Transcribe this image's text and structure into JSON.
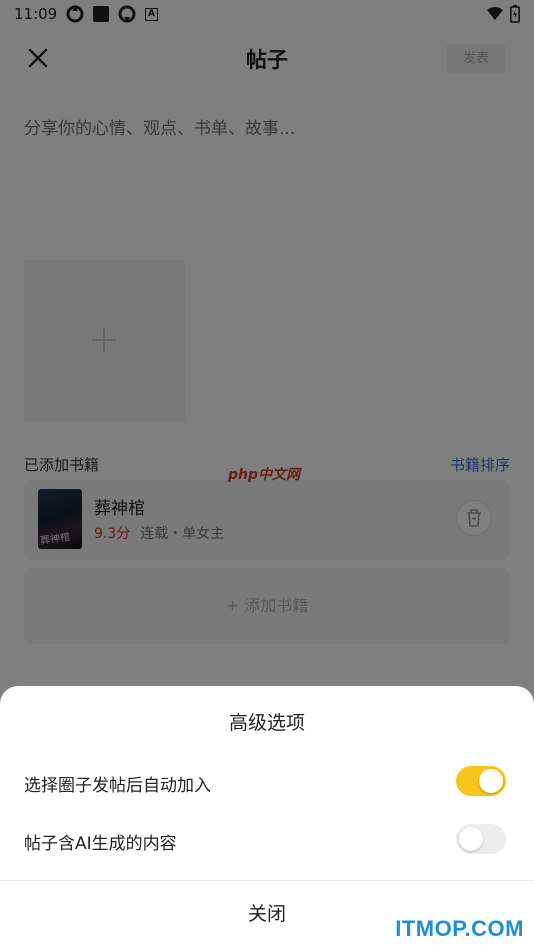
{
  "status_bar": {
    "time": "11:09"
  },
  "topbar": {
    "title": "帖子",
    "publish_label": "发表"
  },
  "post": {
    "placeholder": "分享你的心情、观点、书单、故事..."
  },
  "books": {
    "section_label": "已添加书籍",
    "sort_label": "书籍排序",
    "items": [
      {
        "title": "葬神棺",
        "cover_text": "葬神棺",
        "score": "9.3分",
        "tags": "连载・单女主"
      }
    ],
    "add_label": "+ 添加书籍"
  },
  "watermarks": {
    "php": "php中文网",
    "itmop": "ITMOP.COM"
  },
  "sheet": {
    "title": "高级选项",
    "options": [
      {
        "label": "选择圈子发帖后自动加入",
        "enabled": true
      },
      {
        "label": "帖子含AI生成的内容",
        "enabled": false
      }
    ],
    "close_label": "关闭"
  },
  "colors": {
    "toggle_on": "#f7c51c",
    "score": "#d43a2e",
    "link": "#3b6fc7",
    "watermark": "#1d8fd3"
  }
}
